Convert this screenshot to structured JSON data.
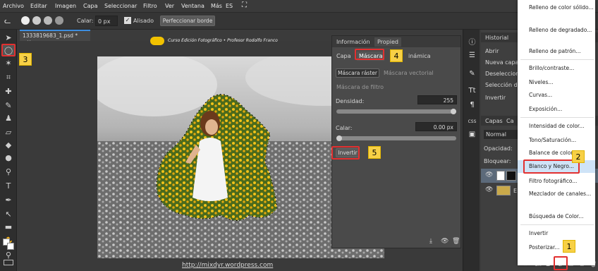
{
  "menubar": {
    "items": [
      "Archivo",
      "Editar",
      "Imagen",
      "Capa",
      "Seleccionar",
      "Filtro",
      "Ver",
      "Ventana",
      "Más"
    ],
    "language": "ES"
  },
  "optbar": {
    "feather_label": "Calar:",
    "feather_value": "0 px",
    "antialias_label": "Alisado",
    "refine_button": "Perfeccionar borde"
  },
  "doc": {
    "tab_name": "1333819683_1.psd *",
    "close": "×",
    "watermark": "Curso Edición Fotográfico • Profesor Rodolfo Franco",
    "footer_url": "http://mixdyr.wordpress.com"
  },
  "props_panel": {
    "tab_info": "Información",
    "tab_props": "Propied",
    "subtab_layer": "Capa",
    "subtab_mask": "Máscara",
    "subtab_dynamic": "inámica",
    "raster_mask": "Máscara ráster",
    "vector_mask": "Máscara vectorial",
    "filter_mask": "Máscara de filtro",
    "density_label": "Densidad:",
    "density_value": "255",
    "density_level": 1.0,
    "feather_label": "Calar:",
    "feather_value": "0.00 px",
    "feather_level": 0.0,
    "invert_button": "Invertir"
  },
  "right_panel": {
    "tab_history": "Historial",
    "history_items": [
      "Abrir",
      "Nueva capa d",
      "Deseleccion",
      "Selección de",
      "Invertir"
    ],
    "tab_layers": "Capas",
    "tab_channels": "Ca",
    "blend_mode": "Normal",
    "opacity_label": "Opacidad:",
    "lock_label": "Bloquear:",
    "layer_label": "E"
  },
  "dropdown": {
    "items": [
      "Relleno de color sólido...",
      "Relleno de degradado...",
      "Relleno de patrón...",
      "Brillo/contraste...",
      "Niveles...",
      "Curvas...",
      "Exposición...",
      "Intensidad de color...",
      "Tono/Saturación...",
      "Balance de color...",
      "Blanco y Negro...",
      "Filtro fotográfico...",
      "Mezclador de canales...",
      "Búsqueda de Color...",
      "Invertir",
      "Posterizar..."
    ]
  },
  "badges": [
    "1",
    "2",
    "3",
    "4",
    "5"
  ],
  "colors": {
    "accent_blue": "#3d8ee0",
    "highlight_red": "#e23030",
    "badge_yellow": "#f7d046"
  }
}
